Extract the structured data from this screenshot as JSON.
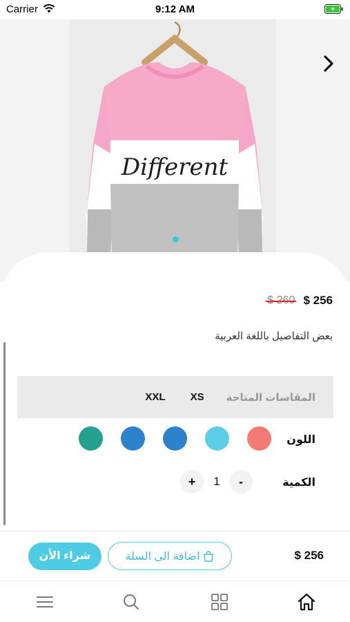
{
  "status_bar": {
    "carrier": "Carrier",
    "time": "9:12 AM"
  },
  "product": {
    "price": "256 $",
    "old_price": "260 $",
    "description": "بعض التفاصيل باللغة العربية",
    "image_print_text": "Different"
  },
  "sizes": {
    "label": "المقاسات المتاحة",
    "options": [
      "XS",
      "XXL"
    ]
  },
  "colors": {
    "label": "اللون",
    "swatches": [
      "#f47b74",
      "#5ccfe6",
      "#2d82cc",
      "#2d82cc",
      "#24a08f"
    ]
  },
  "quantity": {
    "label": "الكمية",
    "value": "1",
    "minus": "-",
    "plus": "+"
  },
  "checkout": {
    "total": "256 $",
    "add_to_cart": "اضافة الى السلة",
    "buy_now": "شراء الأن"
  },
  "nav": {
    "icons": [
      "menu-icon",
      "search-icon",
      "grid-icon",
      "home-icon"
    ]
  },
  "accent_color": "#4fcbe3"
}
